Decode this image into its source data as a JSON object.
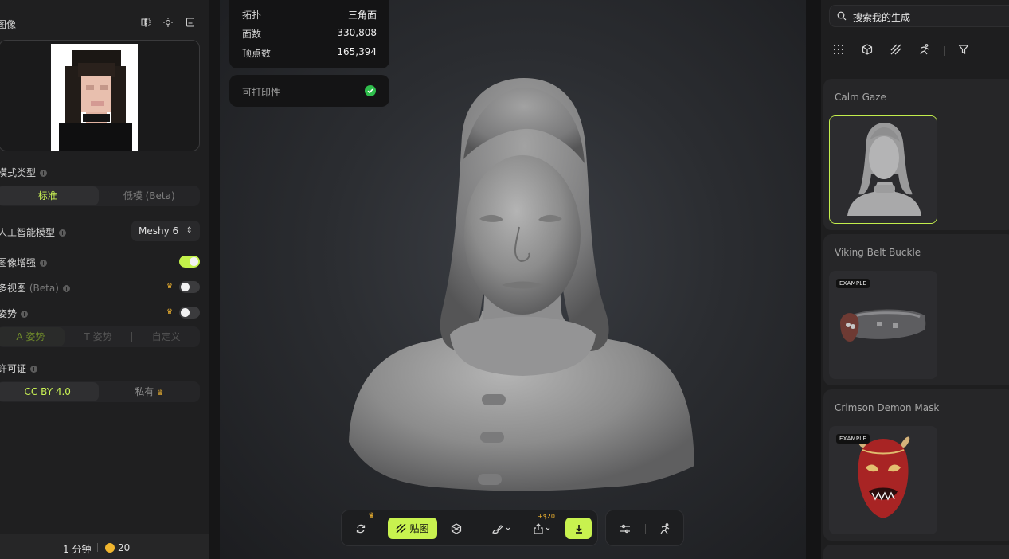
{
  "left_panel": {
    "image_label": "图像",
    "model_type": {
      "label": "模式类型",
      "options": [
        "标准",
        "低模 (Beta)"
      ],
      "selected": "标准"
    },
    "ai_model": {
      "label": "人工智能模型",
      "value": "Meshy 6"
    },
    "image_enhance": {
      "label": "图像增强",
      "on": true
    },
    "multiview": {
      "label": "多视图",
      "beta": "(Beta)",
      "on": false
    },
    "pose": {
      "label": "姿势",
      "on": false,
      "options": [
        "A 姿势",
        "T 姿势",
        "自定义"
      ],
      "selected": "A 姿势"
    },
    "license": {
      "label": "许可证",
      "options": [
        "CC BY 4.0",
        "私有"
      ],
      "selected": "CC BY 4.0"
    },
    "footer": {
      "time": "1 分钟",
      "credits": "20"
    }
  },
  "viewport": {
    "stats": [
      {
        "key": "拓扑",
        "value": "三角面"
      },
      {
        "key": "面数",
        "value": "330,808"
      },
      {
        "key": "顶点数",
        "value": "165,394"
      }
    ],
    "printable_label": "可打印性",
    "toolbar": {
      "texture_label": "贴图",
      "price": "+$20"
    }
  },
  "right_panel": {
    "search_placeholder": "搜索我的生成",
    "cards": [
      {
        "title": "Calm Gaze",
        "example": ""
      },
      {
        "title": "Viking Belt Buckle",
        "example": "EXAMPLE"
      },
      {
        "title": "Crimson Demon Mask",
        "example": "EXAMPLE"
      }
    ]
  },
  "colors": {
    "accent": "#c8f24f",
    "crown": "#f5b731",
    "success": "#2fbe4c",
    "background": "#1b1b1c"
  },
  "icons": [
    "rotate-icon",
    "texture-icon",
    "mesh-icon",
    "brush-icon",
    "share-icon",
    "download-icon",
    "rig-icon",
    "animate-icon",
    "search-icon",
    "grid-icon",
    "cube-icon",
    "stripes-icon",
    "runner-icon",
    "filter-icon",
    "crown-icon",
    "info-icon",
    "check-icon",
    "compare-icon",
    "light-icon",
    "note-icon"
  ]
}
